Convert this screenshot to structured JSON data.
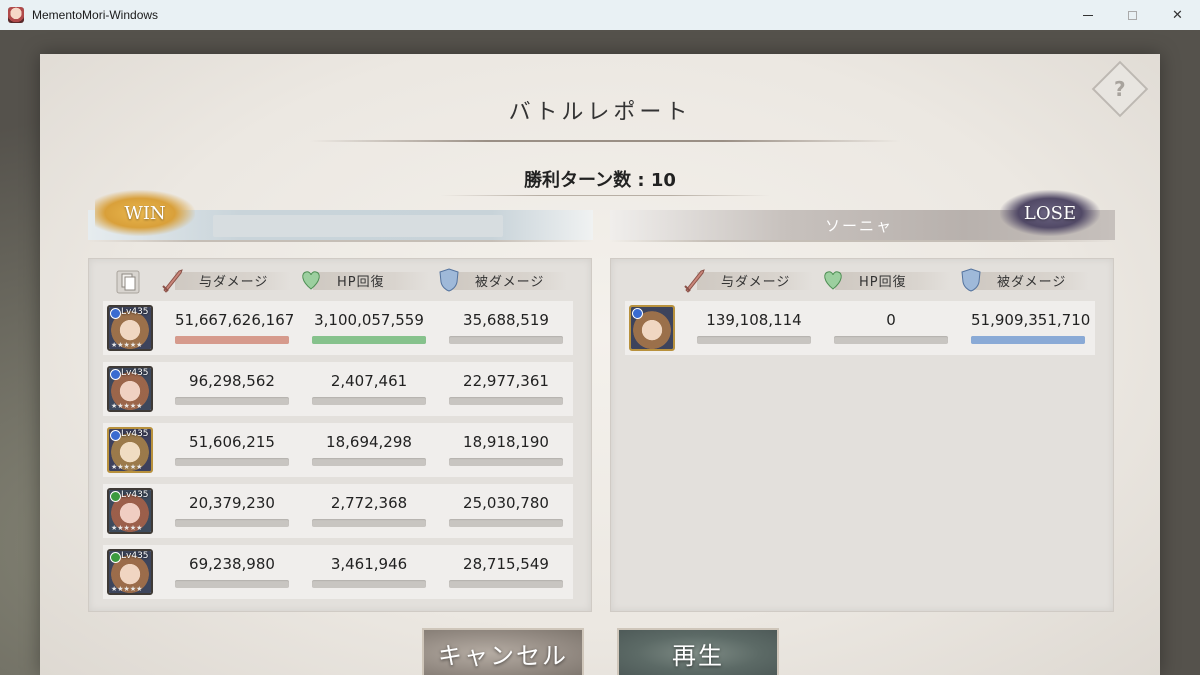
{
  "window": {
    "title": "MementoMori-Windows",
    "controls": {
      "close_glyph": "✕"
    }
  },
  "report": {
    "title": "バトルレポート",
    "help_glyph": "?",
    "victory_turns_label": "勝利ターン数 : 10"
  },
  "left_team": {
    "result": "WIN",
    "name": "",
    "columns": [
      "与ダメージ",
      "HP回復",
      "被ダメージ"
    ],
    "units": [
      {
        "level": "Lv435",
        "element": "blue",
        "frame": "dark",
        "damage_dealt": "51,667,626,167",
        "hp_healed": "3,100,057,559",
        "damage_taken": "35,688,519",
        "bars": [
          1.0,
          1.0,
          0.0
        ]
      },
      {
        "level": "Lv435",
        "element": "blue",
        "frame": "dark",
        "damage_dealt": "96,298,562",
        "hp_healed": "2,407,461",
        "damage_taken": "22,977,361",
        "bars": [
          0,
          0,
          0
        ]
      },
      {
        "level": "Lv435",
        "element": "blue",
        "frame": "gold",
        "damage_dealt": "51,606,215",
        "hp_healed": "18,694,298",
        "damage_taken": "18,918,190",
        "bars": [
          0,
          0,
          0
        ]
      },
      {
        "level": "Lv435",
        "element": "green",
        "frame": "dark",
        "damage_dealt": "20,379,230",
        "hp_healed": "2,772,368",
        "damage_taken": "25,030,780",
        "bars": [
          0,
          0,
          0
        ]
      },
      {
        "level": "Lv435",
        "element": "green",
        "frame": "dark",
        "damage_dealt": "69,238,980",
        "hp_healed": "3,461,946",
        "damage_taken": "28,715,549",
        "bars": [
          0,
          0,
          0
        ]
      }
    ]
  },
  "right_team": {
    "result": "LOSE",
    "name": "ソーニャ",
    "columns": [
      "与ダメージ",
      "HP回復",
      "被ダメージ"
    ],
    "units": [
      {
        "element": "blue",
        "frame": "gold",
        "damage_dealt": "139,108,114",
        "hp_healed": "0",
        "damage_taken": "51,909,351,710",
        "bars": [
          0,
          0,
          1.0
        ]
      }
    ]
  },
  "buttons": {
    "cancel": "キャンセル",
    "play": "再生"
  },
  "colors": {
    "damage_bar": "#d69a8c",
    "heal_bar": "#86c28c",
    "taken_bar": "#8aaad6",
    "empty_bar": "#c8c5c1"
  }
}
